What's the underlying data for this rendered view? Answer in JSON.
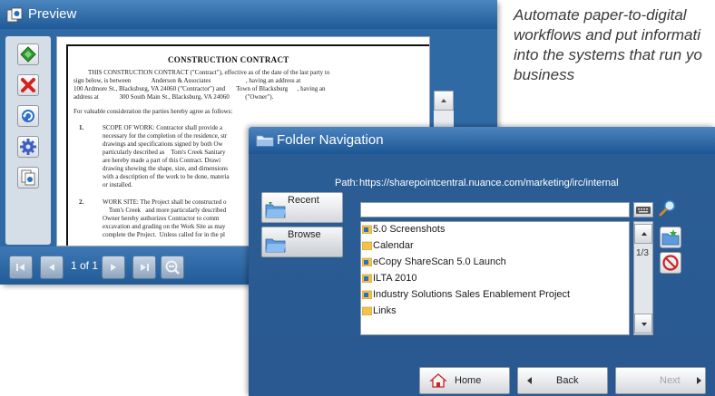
{
  "tagline": "Automate paper-to-digital\nworkflows and put informati\ninto the systems that run yo\nbusiness",
  "preview": {
    "title": "Preview",
    "document": {
      "heading": "CONSTRUCTION CONTRACT",
      "line1": "THIS CONSTRUCTION CONTRACT (\"Contract\"), effective as of the date of the last party to",
      "line2": "sign below, is between             Anderson & Associates                      , having an address at",
      "line3": "100 Ardmore St., Blacksburg, VA 24060 (\"Contractor\") and       Town of Blacksburg      , having an",
      "line4": "address at             300 South Main St., Blacksburg, VA 24060          (\"Owner\").",
      "line5": "For valuable consideration the parties hereby agree as follows:",
      "item1_num": "1.",
      "item1_text": "SCOPE OF WORK: Contractor shall provide a\nnecessary for the completion of the residence, str\ndrawings and specifications signed by both Ow\nparticularly described as    Tom's Creek Sanitary\nare hereby made a part of this Contract. Drawi\ndrawing showing the shape, size, and dimensions\nwith a description of the work to be done, materia\nor installed.",
      "item2_num": "2.",
      "item2_text": "WORK SITE: The Project shall be constructed o\n    Tom's Creek   and more particularly described\nOwner hereby authorizes Contractor to comm\nexcavation and grading on the Work Site as may\ncomplete the Project.  Unless called for in the pl"
    },
    "page_indicator": "1 of 1"
  },
  "folder_navigation": {
    "title": "Folder Navigation",
    "path_label": "Path:",
    "path_value": "https://sharepointcentral.nuance.com/marketing/irc/internal",
    "recent_label": "Recent",
    "browse_label": "Browse",
    "search_value": "",
    "page_count": "1/3",
    "folders": [
      {
        "name": "5.0 Screenshots",
        "type": "sharepoint"
      },
      {
        "name": "Calendar",
        "type": "folder"
      },
      {
        "name": "eCopy ShareScan 5.0 Launch",
        "type": "sharepoint"
      },
      {
        "name": "ILTA 2010",
        "type": "sharepoint"
      },
      {
        "name": "Industry Solutions Sales Enablement Project",
        "type": "sharepoint"
      },
      {
        "name": "Links",
        "type": "folder"
      }
    ],
    "footer": {
      "home_label": "Home",
      "back_label": "Back",
      "next_label": "Next"
    }
  },
  "colors": {
    "window_blue": "#2f6aa5",
    "title_gradient_top": "#4c86c0",
    "folder_yellow": "#f3c24a"
  }
}
